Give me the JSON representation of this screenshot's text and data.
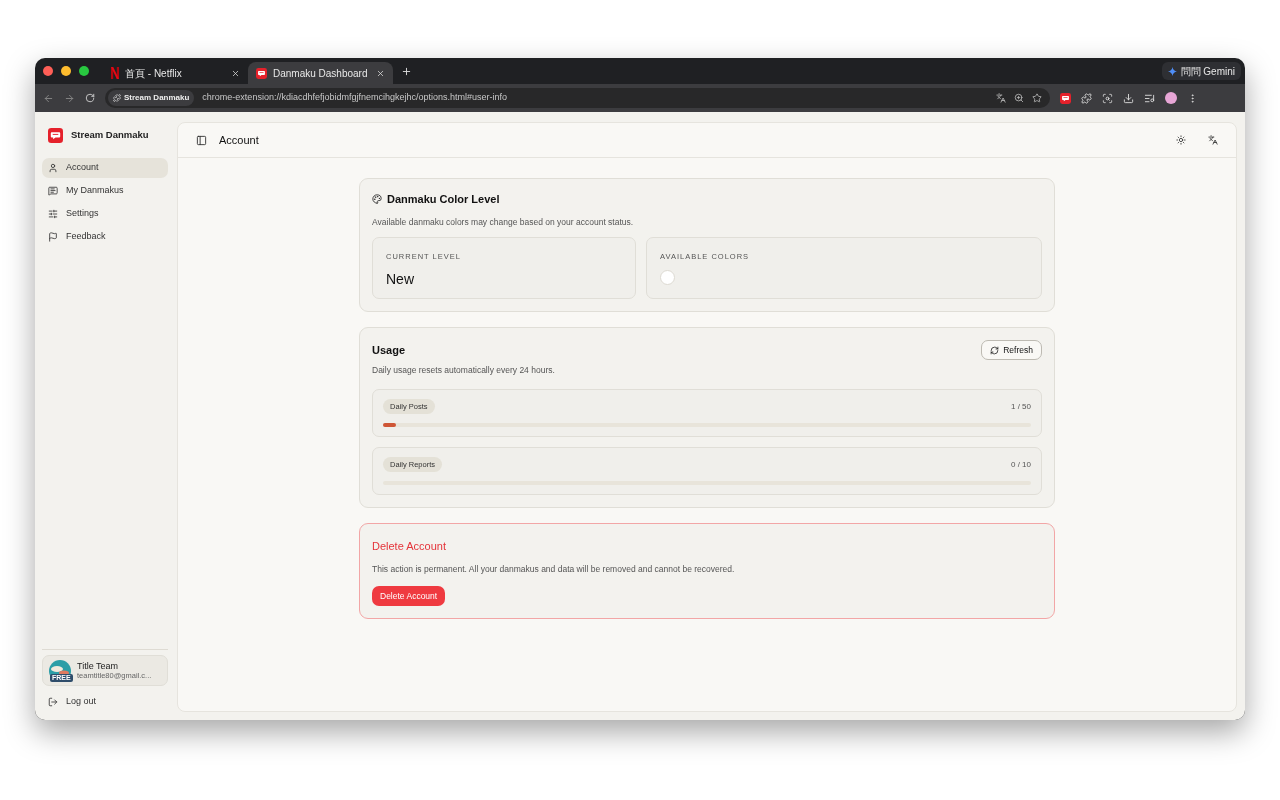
{
  "browser": {
    "tabs": [
      {
        "title": "首頁 - Netflix",
        "kind": "netflix",
        "selected": false
      },
      {
        "title": "Danmaku Dashboard",
        "kind": "app",
        "selected": true
      }
    ],
    "gemini": "問問 Gemini",
    "site_chip": "Stream Danmaku",
    "url": "chrome-extension://kdiacdhfefjobidmfgjfnemcihgkejhc/options.html#user-info"
  },
  "sidebar": {
    "app_name": "Stream Danmaku",
    "items": [
      {
        "label": "Account",
        "kind": "user",
        "selected": true
      },
      {
        "label": "My Danmakus",
        "kind": "list",
        "selected": false
      },
      {
        "label": "Settings",
        "kind": "settings",
        "selected": false
      },
      {
        "label": "Feedback",
        "kind": "flag",
        "selected": false
      }
    ],
    "user": {
      "name": "Title Team",
      "email": "teamtitle80@gmail.c...",
      "badge": "FREE"
    },
    "logout": "Log out"
  },
  "header": {
    "title": "Account"
  },
  "color_level": {
    "title": "Danmaku Color Level",
    "description": "Available danmaku colors may change based on your account status.",
    "current_label": "CURRENT LEVEL",
    "current_value": "New",
    "colors_label": "AVAILABLE COLORS",
    "colors": [
      {
        "color": "#ffffff"
      }
    ]
  },
  "usage": {
    "title": "Usage",
    "refresh": "Refresh",
    "description": "Daily usage resets automatically every 24 hours.",
    "meters": [
      {
        "label": "Daily Posts",
        "reading": "1 / 50",
        "level": 0.02
      },
      {
        "label": "Daily Reports",
        "reading": "0 / 10",
        "level": 0
      }
    ]
  },
  "danger": {
    "title": "Delete Account",
    "description": "This action is permanent. All your danmakus and data will be removed and cannot be recovered.",
    "button": "Delete Account"
  }
}
